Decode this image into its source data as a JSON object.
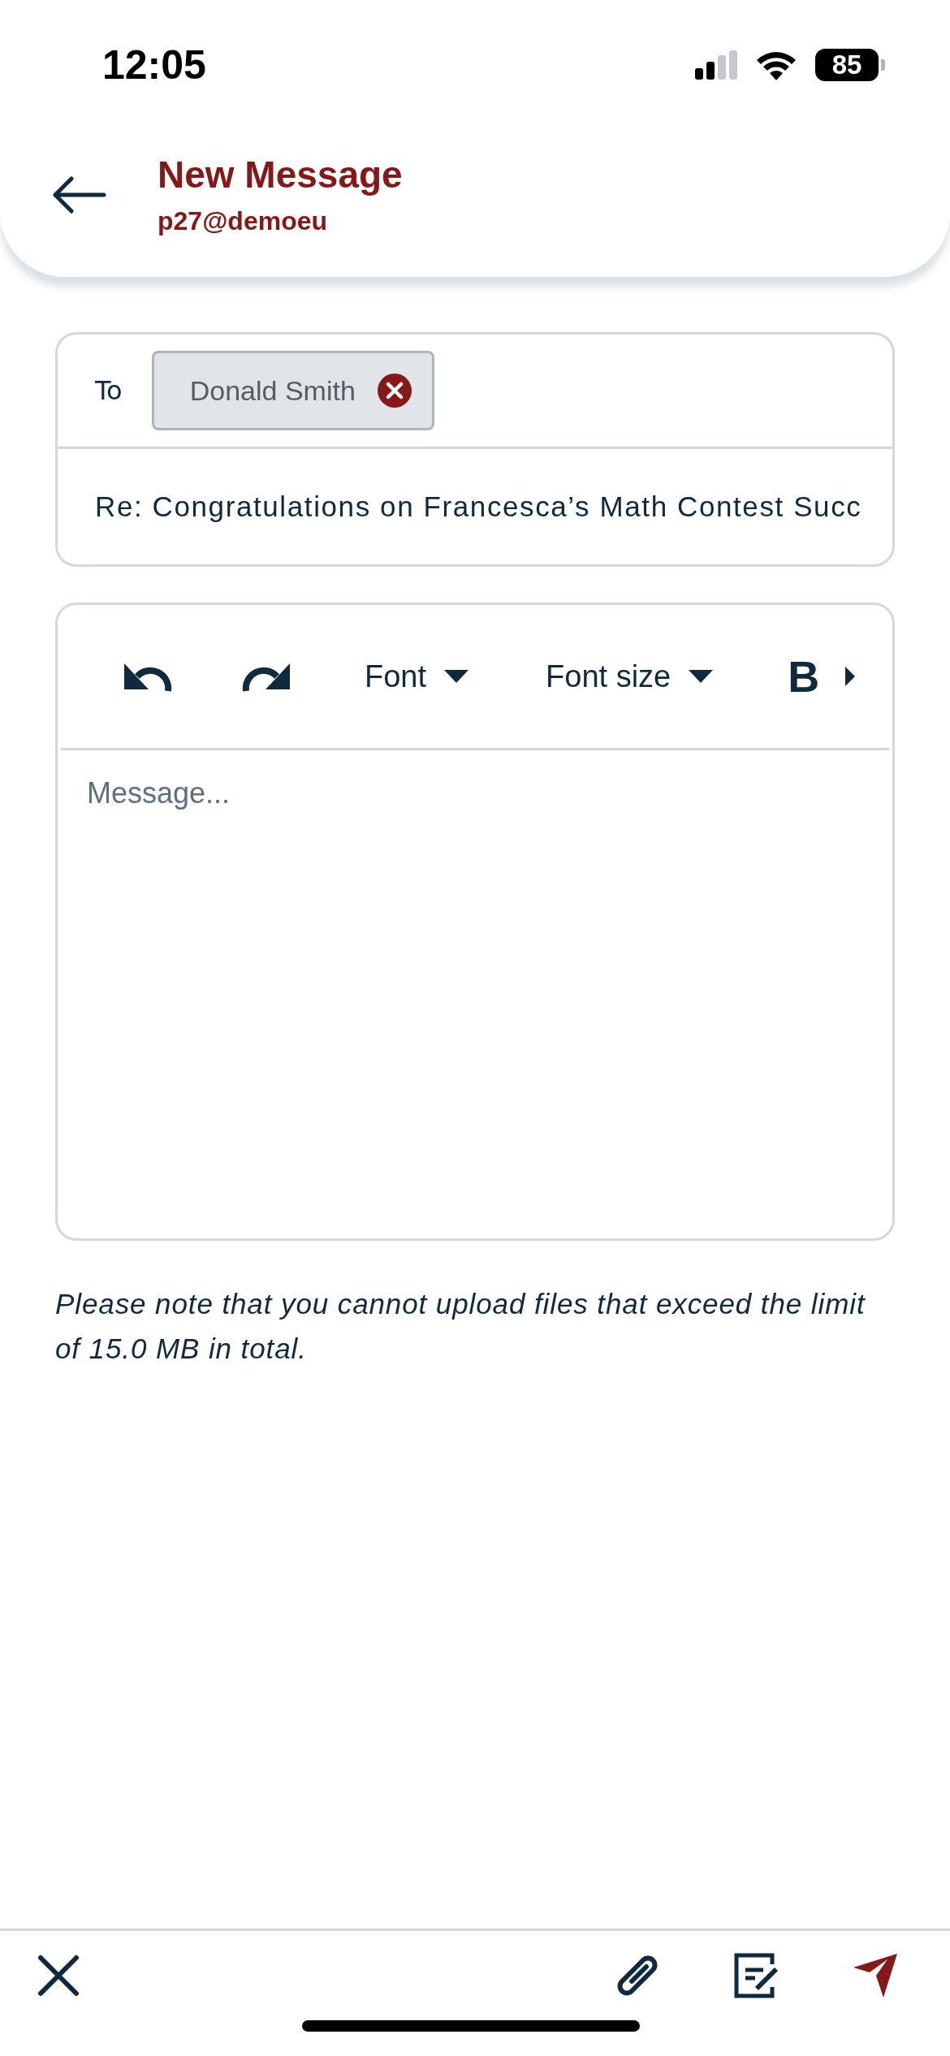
{
  "status_bar": {
    "time": "12:05",
    "battery": "85"
  },
  "header": {
    "title": "New Message",
    "account": "p27@demoeu"
  },
  "compose": {
    "to_label": "To",
    "recipients": [
      {
        "name": "Donald Smith"
      }
    ],
    "subject": "Re: Congratulations on Francesca’s Math Contest Succ"
  },
  "toolbar": [
    {
      "kind": "undo"
    },
    {
      "kind": "redo"
    },
    {
      "kind": "dropdown",
      "label": "Font"
    },
    {
      "kind": "dropdown",
      "label": "Font size"
    },
    {
      "kind": "bold",
      "label": "B"
    },
    {
      "kind": "more"
    }
  ],
  "message": {
    "placeholder": "Message..."
  },
  "note": "Please note that you cannot upload files that exceed the limit of 15.0 MB in total."
}
